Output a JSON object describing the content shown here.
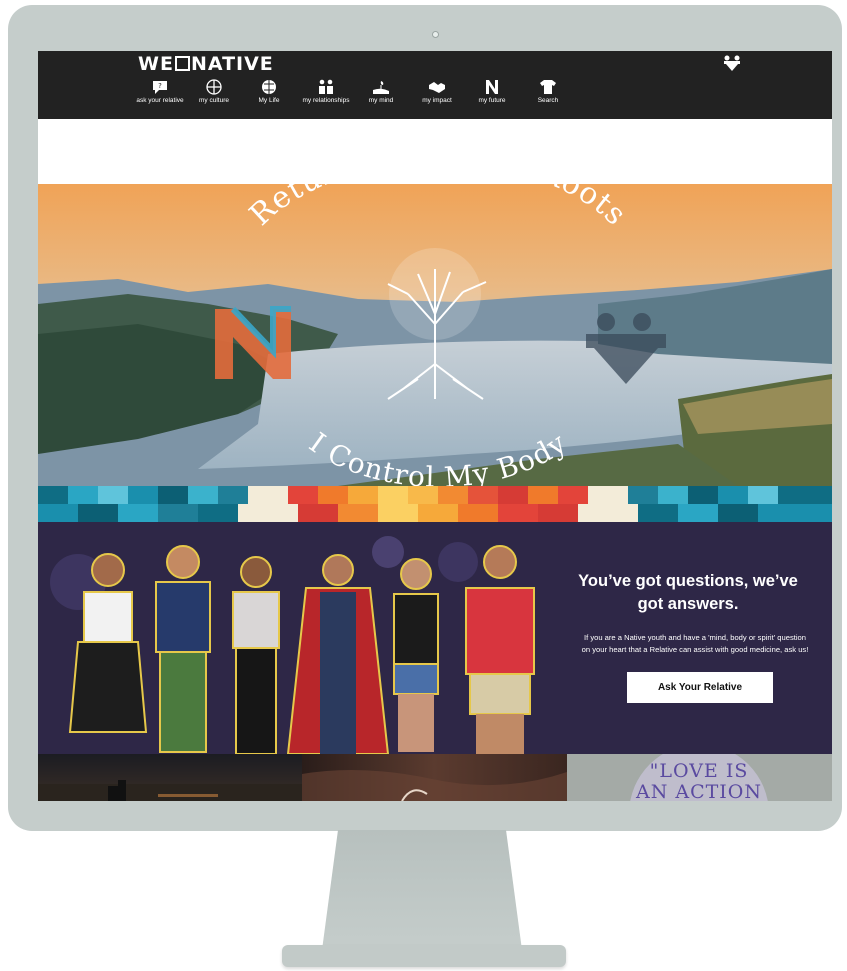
{
  "site": {
    "logo_prefix": "WE",
    "logo_suffix": "NATIVE"
  },
  "nav": [
    {
      "label": "ask your relative",
      "icon": "speech-bubble-icon"
    },
    {
      "label": "my culture",
      "icon": "globe-cross-icon"
    },
    {
      "label": "My Life",
      "icon": "globe-icon"
    },
    {
      "label": "my relationships",
      "icon": "people-icon"
    },
    {
      "label": "my mind",
      "icon": "hand-seedling-icon"
    },
    {
      "label": "my impact",
      "icon": "handshake-icon"
    },
    {
      "label": "my future",
      "icon": "n-logo-icon"
    },
    {
      "label": "Search",
      "icon": "shirt-icon"
    }
  ],
  "hero": {
    "arc_top": "Returning To Our Roots",
    "arc_bottom": "I Control My Body"
  },
  "promo": {
    "title_line1": "You’ve got questions, we’ve",
    "title_line2": "got answers.",
    "body_line1": "If you are a Native youth and have a 'mind, body or spirit' question",
    "body_line2": "on your heart that a Relative can assist with good medicine, ask us!",
    "cta": "Ask Your Relative"
  },
  "thumbnails": {
    "third_line1": "\"LOVE IS",
    "third_line2": "AN ACTION"
  },
  "colors": {
    "navbar": "#222222",
    "promo_bg": "#2e2747",
    "monitor": "#c5cdcb"
  }
}
